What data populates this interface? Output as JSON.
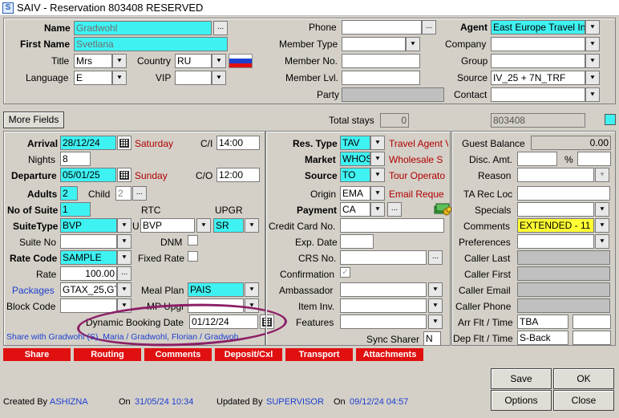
{
  "window": {
    "title": "SAIV - Reservation 803408  RESERVED"
  },
  "guest": {
    "name_label": "Name",
    "name": "Gradwohl",
    "first_name_label": "First Name",
    "first_name": "Svetlana",
    "title_label": "Title",
    "title": "Mrs",
    "country_label": "Country",
    "country": "RU",
    "language_label": "Language",
    "language": "E",
    "vip_label": "VIP",
    "vip": ""
  },
  "contact": {
    "phone_label": "Phone",
    "phone": "",
    "member_type_label": "Member Type",
    "member_type": "",
    "member_no_label": "Member No.",
    "member_no": "",
    "member_lvl_label": "Member Lvl.",
    "member_lvl": "",
    "party_label": "Party",
    "party": ""
  },
  "agent": {
    "agent_label": "Agent",
    "agent": "East Europe Travel In",
    "company_label": "Company",
    "company": "",
    "group_label": "Group",
    "group": "",
    "source_label": "Source",
    "source": "IV_25 + 7N_TRF",
    "contact_label": "Contact",
    "contact": ""
  },
  "more_fields": "More Fields",
  "total_stays_label": "Total stays",
  "total_stays": "0",
  "reservation_no": "803408",
  "stay": {
    "arrival_label": "Arrival",
    "arrival": "28/12/24",
    "arrival_day": "Saturday",
    "ci_label": "C/I",
    "ci": "14:00",
    "nights_label": "Nights",
    "nights": "8",
    "departure_label": "Departure",
    "departure": "05/01/25",
    "departure_day": "Sunday",
    "co_label": "C/O",
    "co": "12:00",
    "adults_label": "Adults",
    "adults": "2",
    "child_label": "Child",
    "child": "2",
    "no_suite_label": "No of Suite",
    "no_suite": "1",
    "rtc_label": "RTC",
    "upgr_label": "UPGR",
    "suite_type_label": "SuiteType",
    "suite_type": "BVP",
    "u_label": "U",
    "rtc": "BVP",
    "upgr": "SR",
    "suite_no_label": "Suite No",
    "suite_no": "",
    "dnm_label": "DNM",
    "rate_code_label": "Rate Code",
    "rate_code": "SAMPLE",
    "fixed_rate_label": "Fixed Rate",
    "rate_label": "Rate",
    "rate": "100.00",
    "packages_label": "Packages",
    "packages": "GTAX_25,GT",
    "meal_plan_label": "Meal Plan",
    "meal_plan": "PAIS",
    "block_code_label": "Block Code",
    "block_code": "",
    "mp_upgr_label": "MP Upgr",
    "dyn_label": "Dynamic Booking Date",
    "dyn_date": "01/12/24",
    "share_text": "Share with Gradwohl (S), Maria / Gradwohl, Florian / Gradwoh"
  },
  "res": {
    "res_type_label": "Res. Type",
    "res_type": "TAV",
    "res_type_desc": "Travel Agent V",
    "market_label": "Market",
    "market": "WHOS",
    "market_desc": "Wholesale S",
    "source_label": "Source",
    "source": "TO",
    "source_desc": "Tour Operato",
    "origin_label": "Origin",
    "origin": "EMA",
    "origin_desc": "Email Reque",
    "payment_label": "Payment",
    "payment": "CA",
    "cc_label": "Credit Card No.",
    "cc": "",
    "exp_label": "Exp. Date",
    "exp": "",
    "crs_label": "CRS No.",
    "crs": "",
    "confirm_label": "Confirmation",
    "ambassador_label": "Ambassador",
    "ambassador": "",
    "item_inv_label": "Item Inv.",
    "item_inv": "",
    "features_label": "Features",
    "features": "",
    "sync_label": "Sync Sharer",
    "sync": "N"
  },
  "right": {
    "guest_balance_label": "Guest Balance",
    "guest_balance": "0.00",
    "disc_label": "Disc. Amt.",
    "pct": "%",
    "reason_label": "Reason",
    "ta_rec_label": "TA Rec Loc",
    "specials_label": "Specials",
    "comments_label": "Comments",
    "comments": "EXTENDED - 11",
    "preferences_label": "Preferences",
    "caller_last_label": "Caller Last",
    "caller_first_label": "Caller First",
    "caller_email_label": "Caller Email",
    "caller_phone_label": "Caller Phone",
    "arr_flt_label": "Arr Flt / Time",
    "arr_flt": "TBA",
    "dep_flt_label": "Dep Flt / Time",
    "dep_flt": "S-Back"
  },
  "tabs": [
    "Share",
    "Routing",
    "Comments",
    "Deposit/Cxl",
    "Transport",
    "Attachments"
  ],
  "buttons": {
    "save": "Save",
    "ok": "OK",
    "options": "Options",
    "close": "Close"
  },
  "footer": {
    "created_by_label": "Created By",
    "created_by": "ASHIZNA",
    "on1_label": "On",
    "created_on": "31/05/24 10:34",
    "updated_by_label": "Updated By",
    "updated_by": "SUPERVISOR",
    "on2_label": "On",
    "updated_on": "09/12/24 04:57"
  },
  "colors": {
    "field_highlight": "#3ff2f2",
    "tabs": "#e01010",
    "description_text": "#b00000",
    "annotation_circle": "#8c1f66"
  },
  "icons": [
    "app-icon",
    "dropdown-arrow-icon",
    "calendar-icon",
    "russia-flag-icon",
    "money-icon"
  ]
}
